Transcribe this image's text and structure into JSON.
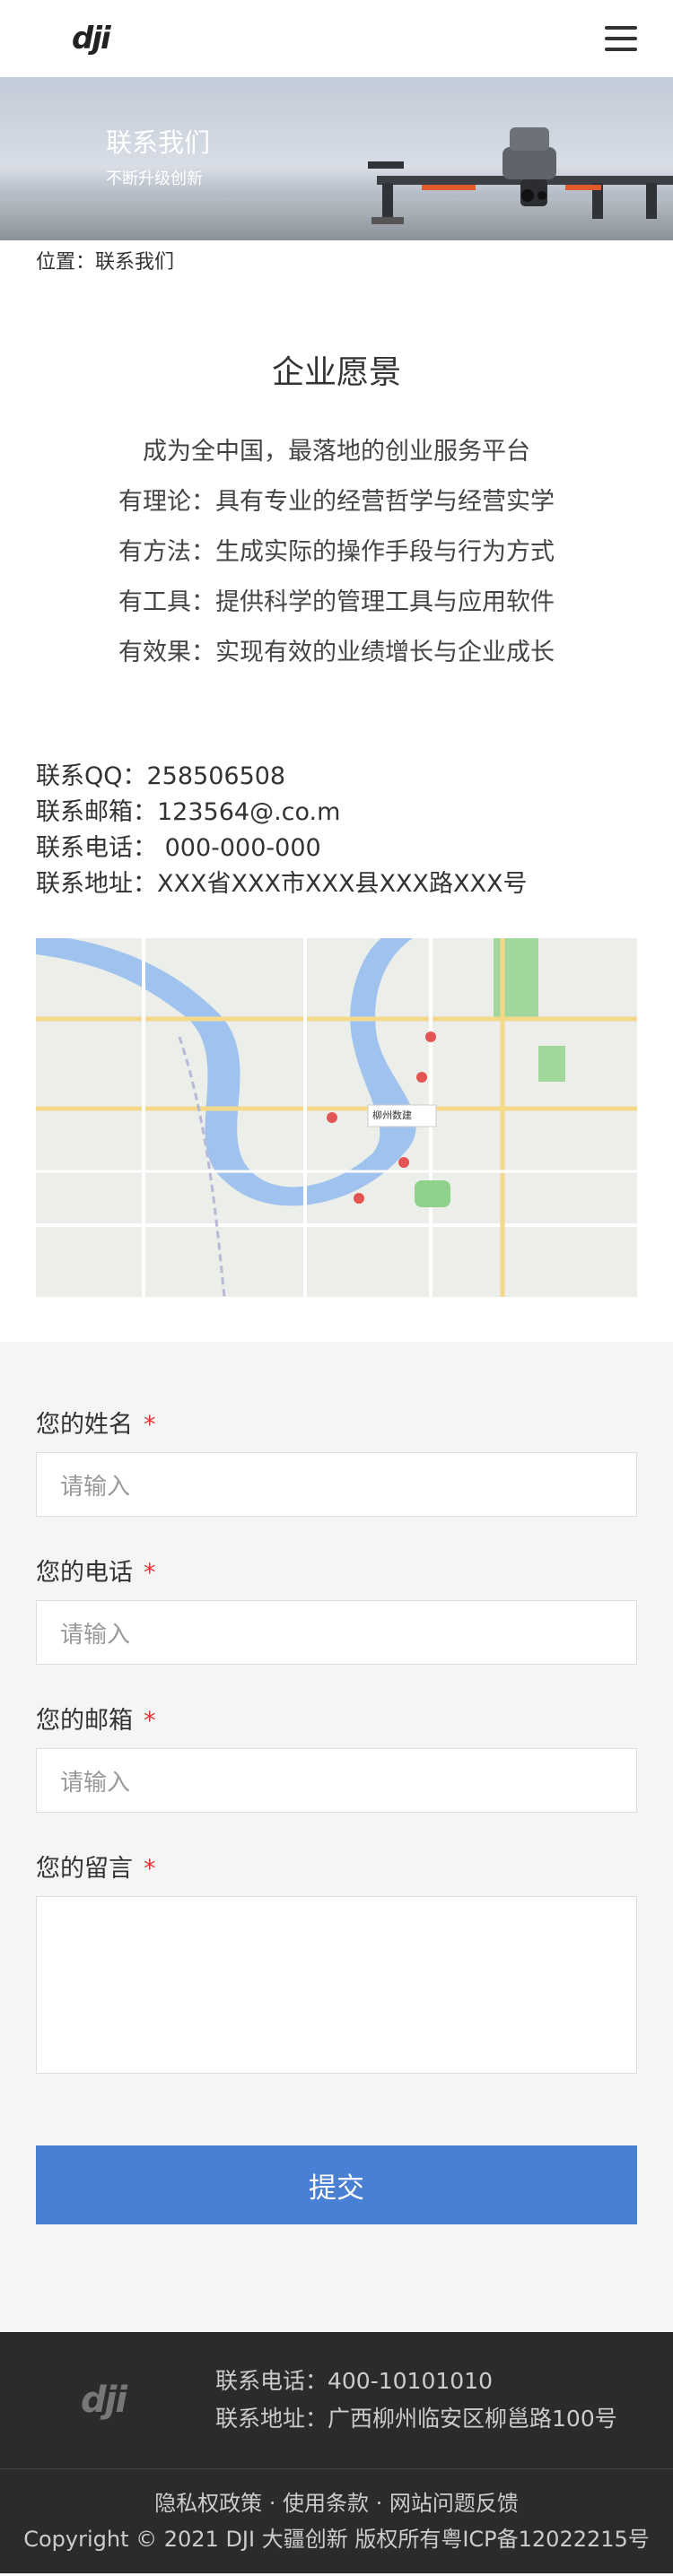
{
  "header": {
    "logo": "dji",
    "menu_icon": "hamburger-menu-icon"
  },
  "banner": {
    "title": "联系我们",
    "subtitle": "不断升级创新"
  },
  "location": {
    "text": "位置：联系我们"
  },
  "vision": {
    "title": "企业愿景",
    "lines": [
      "成为全中国，最落地的创业服务平台",
      "有理论：具有专业的经营哲学与经营实学",
      "有方法：生成实际的操作手段与行为方式",
      "有工具：提供科学的管理工具与应用软件",
      "有效果：实现有效的业绩增长与企业成长"
    ]
  },
  "contact": {
    "qq": "联系QQ：258506508",
    "email": "联系邮箱：123564@.co.m",
    "phone": "联系电话： 000-000-000",
    "address": "联系地址：XXX省XXX市XXX县XXX路XXX号"
  },
  "map": {
    "marker_label": "柳州数建"
  },
  "form": {
    "name_label": "您的姓名",
    "phone_label": "您的电话",
    "email_label": "您的邮箱",
    "message_label": "您的留言",
    "required_mark": "*",
    "placeholder": "请输入",
    "submit_label": "提交"
  },
  "footer": {
    "logo": "dji",
    "phone": "联系电话：400-10101010",
    "address": "联系地址：广西柳州临安区柳邕路100号",
    "links": [
      "隐私权政策",
      "使用条款",
      "网站问题反馈"
    ],
    "separator": " · ",
    "copyright": "Copyright © 2021 DJI 大疆创新 版权所有粤ICP备12022215号"
  }
}
